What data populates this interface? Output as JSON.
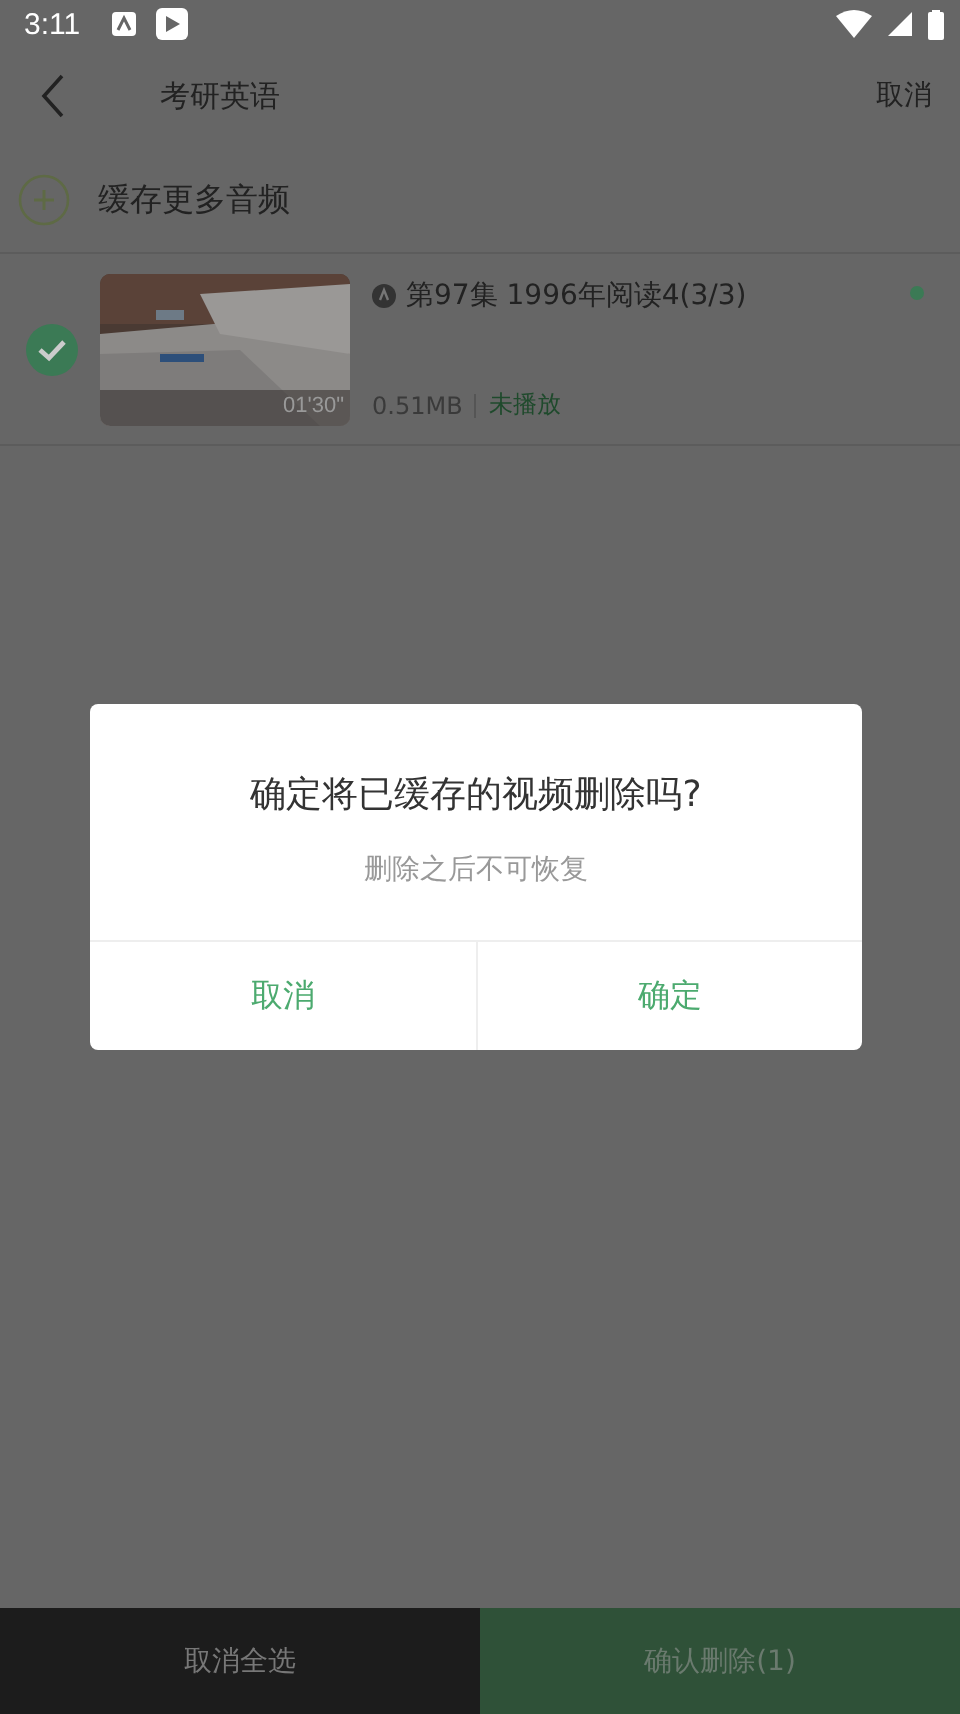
{
  "status_bar": {
    "time": "3:11"
  },
  "header": {
    "title": "考研英语",
    "action": "取消"
  },
  "add_more": {
    "label": "缓存更多音频"
  },
  "items": [
    {
      "checked": true,
      "duration": "01'30\"",
      "title": "第97集 1996年阅读4(3/3)",
      "size": "0.51MB",
      "status": "未播放",
      "new": true
    }
  ],
  "dialog": {
    "title": "确定将已缓存的视频删除吗?",
    "message": "删除之后不可恢复",
    "buttons": [
      "取消",
      "确定"
    ]
  },
  "bottom_bar": {
    "deselect": "取消全选",
    "confirm": "确认删除(1)"
  }
}
